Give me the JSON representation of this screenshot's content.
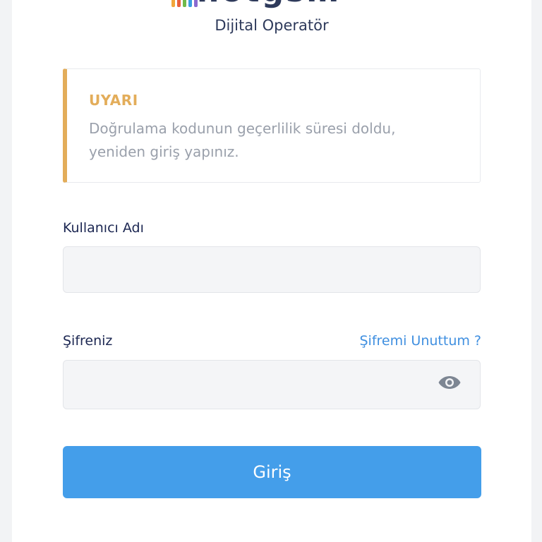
{
  "brand": {
    "name": "hotgsm",
    "subtitle": "Dijital Operatör",
    "bar_colors": [
      "#f2a63a",
      "#e8603c",
      "#6fb94a",
      "#3a9fe0",
      "#8a6ad0"
    ]
  },
  "alert": {
    "title": "UYARI",
    "message": "Doğrulama kodunun geçerlilik süresi doldu, yeniden giriş yapınız.",
    "accent_color": "#e3ad5a"
  },
  "form": {
    "username_label": "Kullanıcı Adı",
    "username_value": "",
    "password_label": "Şifreniz",
    "password_value": "",
    "forgot_label": "Şifremi Unuttum ?",
    "show_password_icon": "eye-icon",
    "submit_label": "Giriş"
  },
  "colors": {
    "primary": "#449eea",
    "link": "#3f8fe0",
    "label": "#1c2752"
  }
}
